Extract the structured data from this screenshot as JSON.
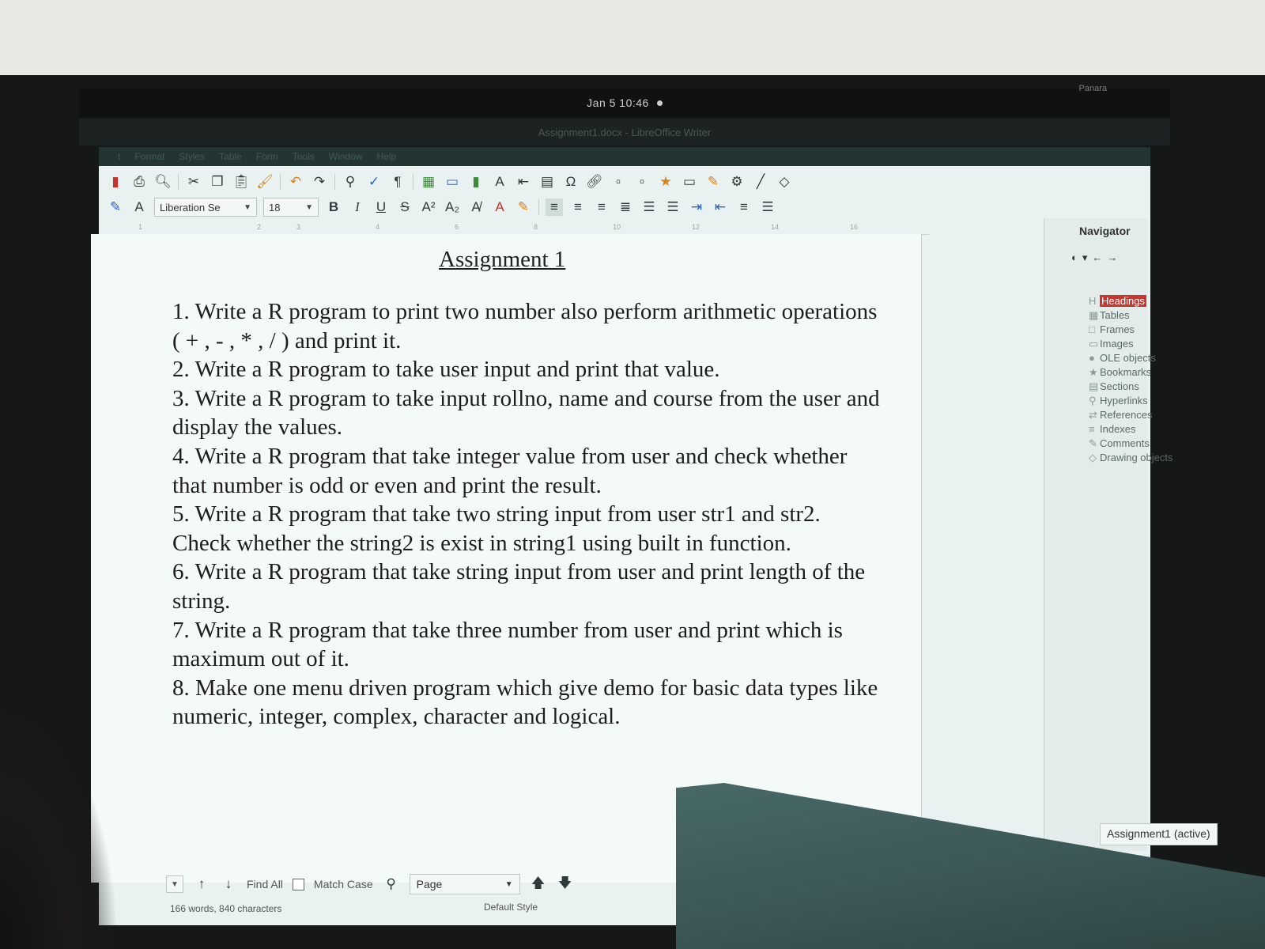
{
  "topbar": {
    "clock": "Jan 5  10:46",
    "brand": "Panara"
  },
  "window": {
    "title": "Assignment1.docx - LibreOffice Writer"
  },
  "menu": [
    "t",
    "Format",
    "Styles",
    "Table",
    "Form",
    "Tools",
    "Window",
    "Help"
  ],
  "toolbar2": {
    "font_name": "Liberation Se",
    "font_size": "18",
    "buttons": {
      "bold": "B",
      "italic": "I",
      "underline": "U",
      "strike": "S"
    }
  },
  "document": {
    "title": "Assignment 1",
    "paragraphs": [
      "1. Write a R program to print two number also perform arithmetic operations ( + , - , * , / ) and print it.",
      "2. Write a R program to take user input and print that value.",
      "3. Write a R program to take input rollno, name and course from the user and display the values.",
      "4. Write a R program that take integer value from user and check whether that number is odd or even and print the result.",
      "5. Write a R program that take two string input from user str1 and str2. Check whether the string2 is exist in string1 using built in function.",
      "6. Write a R program that take string input from user and print length of the string.",
      "7. Write a R program that take three number from user and print which is maximum out of it.",
      "8. Make one menu driven program which give demo for basic data types like numeric, integer, complex, character and logical."
    ]
  },
  "findbar": {
    "find_all": "Find All",
    "match_case": "Match Case",
    "page_select": "Page"
  },
  "status": {
    "words": "166 words, 840 characters",
    "style": "Default Style"
  },
  "navigator": {
    "title": "Navigator",
    "items": [
      {
        "label": "Headings",
        "icon": "H"
      },
      {
        "label": "Tables",
        "icon": "▦"
      },
      {
        "label": "Frames",
        "icon": "□"
      },
      {
        "label": "Images",
        "icon": "▭"
      },
      {
        "label": "OLE objects",
        "icon": "●"
      },
      {
        "label": "Bookmarks",
        "icon": "★"
      },
      {
        "label": "Sections",
        "icon": "▤"
      },
      {
        "label": "Hyperlinks",
        "icon": "⚲"
      },
      {
        "label": "References",
        "icon": "⇄"
      },
      {
        "label": "Indexes",
        "icon": "≡"
      },
      {
        "label": "Comments",
        "icon": "✎"
      },
      {
        "label": "Drawing objects",
        "icon": "◇"
      }
    ],
    "footer": "Assignment1 (active)"
  }
}
